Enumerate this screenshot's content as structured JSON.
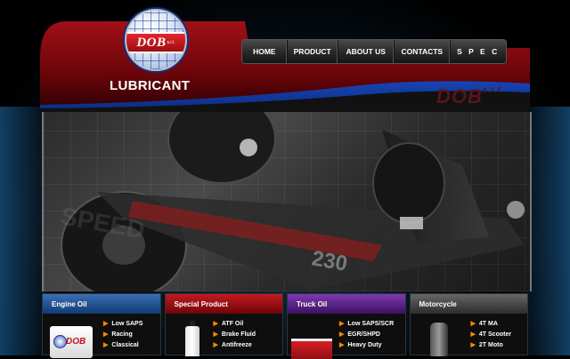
{
  "brand": {
    "logo_text": "DOB",
    "logo_suffix": "s.r.l.",
    "registered_mark": "®",
    "tagline": "LUBRICANT",
    "ghost_logo_text": "DOB",
    "ghost_logo_suffix": "s.r.l."
  },
  "nav": {
    "items": [
      {
        "label": "HOME"
      },
      {
        "label": "PRODUCT"
      },
      {
        "label": "ABOUT US"
      },
      {
        "label": "CONTACTS"
      },
      {
        "label": "S P E C"
      }
    ]
  },
  "hero": {
    "watermark_text": "SPEED",
    "car_number": "230"
  },
  "categories": [
    {
      "title": "Engine Oil",
      "product_brand": "DOB",
      "items": [
        "Low SAPS",
        "Racing",
        "Classical"
      ]
    },
    {
      "title": "Special Product",
      "items": [
        "ATF Oil",
        "Brake Fluid",
        "Antifreeze"
      ]
    },
    {
      "title": "Truck Oil",
      "items": [
        "Low SAPS/SCR",
        "EGR/SHPD",
        "Heavy Duty"
      ]
    },
    {
      "title": "Motorcycle",
      "items": [
        "4T MA",
        "4T Scooter",
        "2T Moto"
      ]
    }
  ],
  "icons": {
    "list_bullet": "arrow-right-icon"
  },
  "colors": {
    "header_red": "#9b0f14",
    "header_blue": "#1947b8",
    "accent_orange": "#ff8a00",
    "engine_blue": "#3a6fb4",
    "special_red": "#c21a20",
    "truck_purple": "#7c3ab0",
    "moto_gray": "#666666"
  }
}
